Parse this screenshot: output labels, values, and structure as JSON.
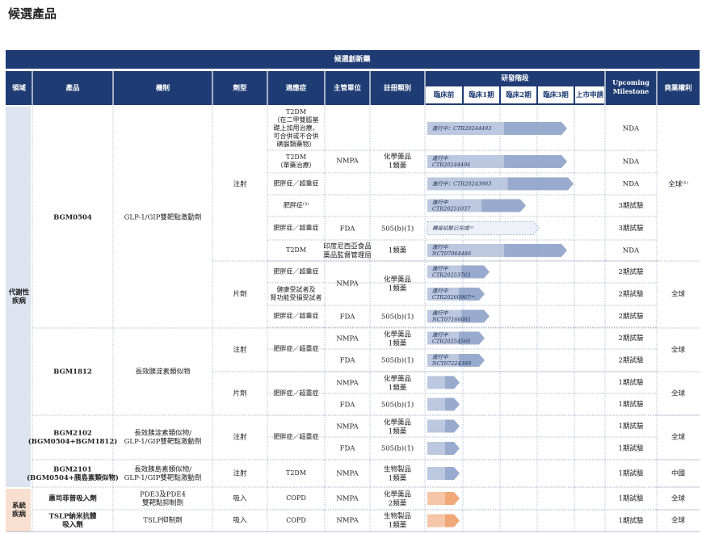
{
  "page_title": "候選產品",
  "banner": "候選創新藥",
  "headers": {
    "domain": "領域",
    "product": "產品",
    "mechanism": "機制",
    "dosage": "劑型",
    "indication": "適應症",
    "authority": "主管單位",
    "reg_class": "註冊類別",
    "stage": "研發階段",
    "phases": [
      "臨床前",
      "臨床1期",
      "臨床2期",
      "臨床3期",
      "上市申請"
    ],
    "milestone": "Upcoming Milestone",
    "rights": "商業權利"
  },
  "domains": [
    {
      "name": "代謝性疾病"
    },
    {
      "name": "系統疾病"
    }
  ],
  "products": [
    {
      "name": "BGM0504",
      "mechanism": "GLP-1/GIP雙靶點激動劑"
    },
    {
      "name": "BGM1812",
      "mechanism": "長效胰淀素類似物"
    },
    {
      "name": "BGM2102",
      "name2": "(BGM0504+BGM1812)",
      "mechanism": "長效胰淀素類似物/",
      "mechanism2": "GLP-1/GIP雙靶點激動劑"
    },
    {
      "name": "BGM2101",
      "name2": "(BGM0504+胰島素類似物)",
      "mechanism": "長效胰島素類似物/",
      "mechanism2": "GLP-1/GIP雙靶點激動劑"
    },
    {
      "name": "惠司菲普吸入劑",
      "mechanism": "PDE3及PDE4",
      "mechanism2": "雙靶點抑制劑"
    },
    {
      "name": "TSLP納米抗體",
      "name2": "吸入劑",
      "mechanism": "TSLP抑制劑"
    }
  ],
  "dosage_groups": [
    "注射",
    "片劑",
    "注射",
    "片劑",
    "注射",
    "注射",
    "吸入",
    "吸入"
  ],
  "rights_groups": [
    "全球⁽¹⁾",
    "全球",
    "全球",
    "全球",
    "全球",
    "中國",
    "全球",
    "全球"
  ],
  "rows": [
    {
      "indication": [
        "T2DM",
        "（在二甲雙胍基",
        "礎上加用治療，",
        "可合併或不合併",
        "磺脲類藥物）"
      ],
      "bar_label": "進行中：CTR20244493",
      "milestone": "NDA"
    },
    {
      "indication": [
        "T2DM",
        "（單藥治療）"
      ],
      "bar_label": "進行中",
      "bar_label2": "CTR20244494",
      "milestone": "NDA"
    },
    {
      "indication": [
        "肥胖症／超重症"
      ],
      "bar_label": "進行中：CTR20243983",
      "milestone": "NDA"
    },
    {
      "indication": [
        "肥胖症⁽³⁾"
      ],
      "bar_label": "進行中",
      "bar_label2": "CTR20251037",
      "milestone": "3期試驗"
    },
    {
      "indication": [
        "肥胖症／超重症"
      ],
      "bar_label": "橋接試驗已完成⁽²⁾",
      "milestone": "3期試驗"
    },
    {
      "indication": [
        "T2DM"
      ],
      "bar_label": "進行中",
      "bar_label2": "NCT07064486",
      "milestone": "NDA"
    },
    {
      "indication": [
        "肥胖症／超重症"
      ],
      "bar_label": "進行中",
      "bar_label2": "CTR20253763",
      "milestone": "2期試驗"
    },
    {
      "indication": [
        "健康受試者及",
        "腎功能受損受試者"
      ],
      "bar_label": "進行中",
      "bar_label2": "CTR20260967⁽⁴⁾",
      "milestone": "2期試驗"
    },
    {
      "indication": [
        "肥胖症／超重症"
      ],
      "bar_label": "進行中",
      "bar_label2": "NCT07166081",
      "milestone": "2期試驗"
    },
    {
      "indication": [],
      "bar_label": "進行中",
      "bar_label2": "CTR20254560",
      "milestone": "2期試驗"
    },
    {
      "indication": [],
      "bar_label": "進行中",
      "bar_label2": "NCT07224399",
      "milestone": "2期試驗"
    },
    {
      "indication": [],
      "bar_label": "",
      "milestone": "1期試驗"
    },
    {
      "indication": [],
      "bar_label": "",
      "milestone": "1期試驗"
    },
    {
      "indication": [],
      "bar_label": "",
      "milestone": "1期試驗"
    },
    {
      "indication": [],
      "bar_label": "",
      "milestone": "1期試驗"
    },
    {
      "indication": [
        "T2DM"
      ],
      "bar_label": "",
      "milestone": "1期試驗"
    },
    {
      "indication": [
        "COPD"
      ],
      "bar_label": "",
      "milestone": "1期試驗"
    },
    {
      "indication": [
        "COPD"
      ],
      "bar_label": "",
      "milestone": "1期試驗"
    }
  ],
  "merged_indications": [
    "肥胖症／超重症",
    "肥胖症／超重症",
    "肥胖症／超重症"
  ],
  "authorities": [
    "NMPA",
    "FDA",
    "印度尼西亞食品",
    "藥品監督管理局",
    "NMPA",
    "FDA",
    "NMPA",
    "FDA",
    "NMPA",
    "FDA",
    "NMPA",
    "FDA",
    "NMPA",
    "NMPA",
    "NMPA"
  ],
  "reg_classes": [
    "化學藥品",
    "1類藥",
    "505(b)(1)",
    "1類藥",
    "化學藥品",
    "1類藥",
    "505(b)(1)",
    "化學藥品",
    "1類藥",
    "505(b)(1)",
    "化學藥品",
    "1類藥",
    "505(b)(1)",
    "化學藥品",
    "1類藥",
    "505(b)(1)",
    "生物製品",
    "1類藥",
    "化學藥品",
    "2類藥",
    "生物製品",
    "1類藥"
  ],
  "colors": {
    "header_bg": "#1f3b73",
    "domain1_bg": "#dde3ef",
    "domain2_bg": "#f8dfcf",
    "bar_blue": "#8da2c9",
    "bar_orange": "#ee9f6a",
    "grid": "#9aa6bf"
  }
}
